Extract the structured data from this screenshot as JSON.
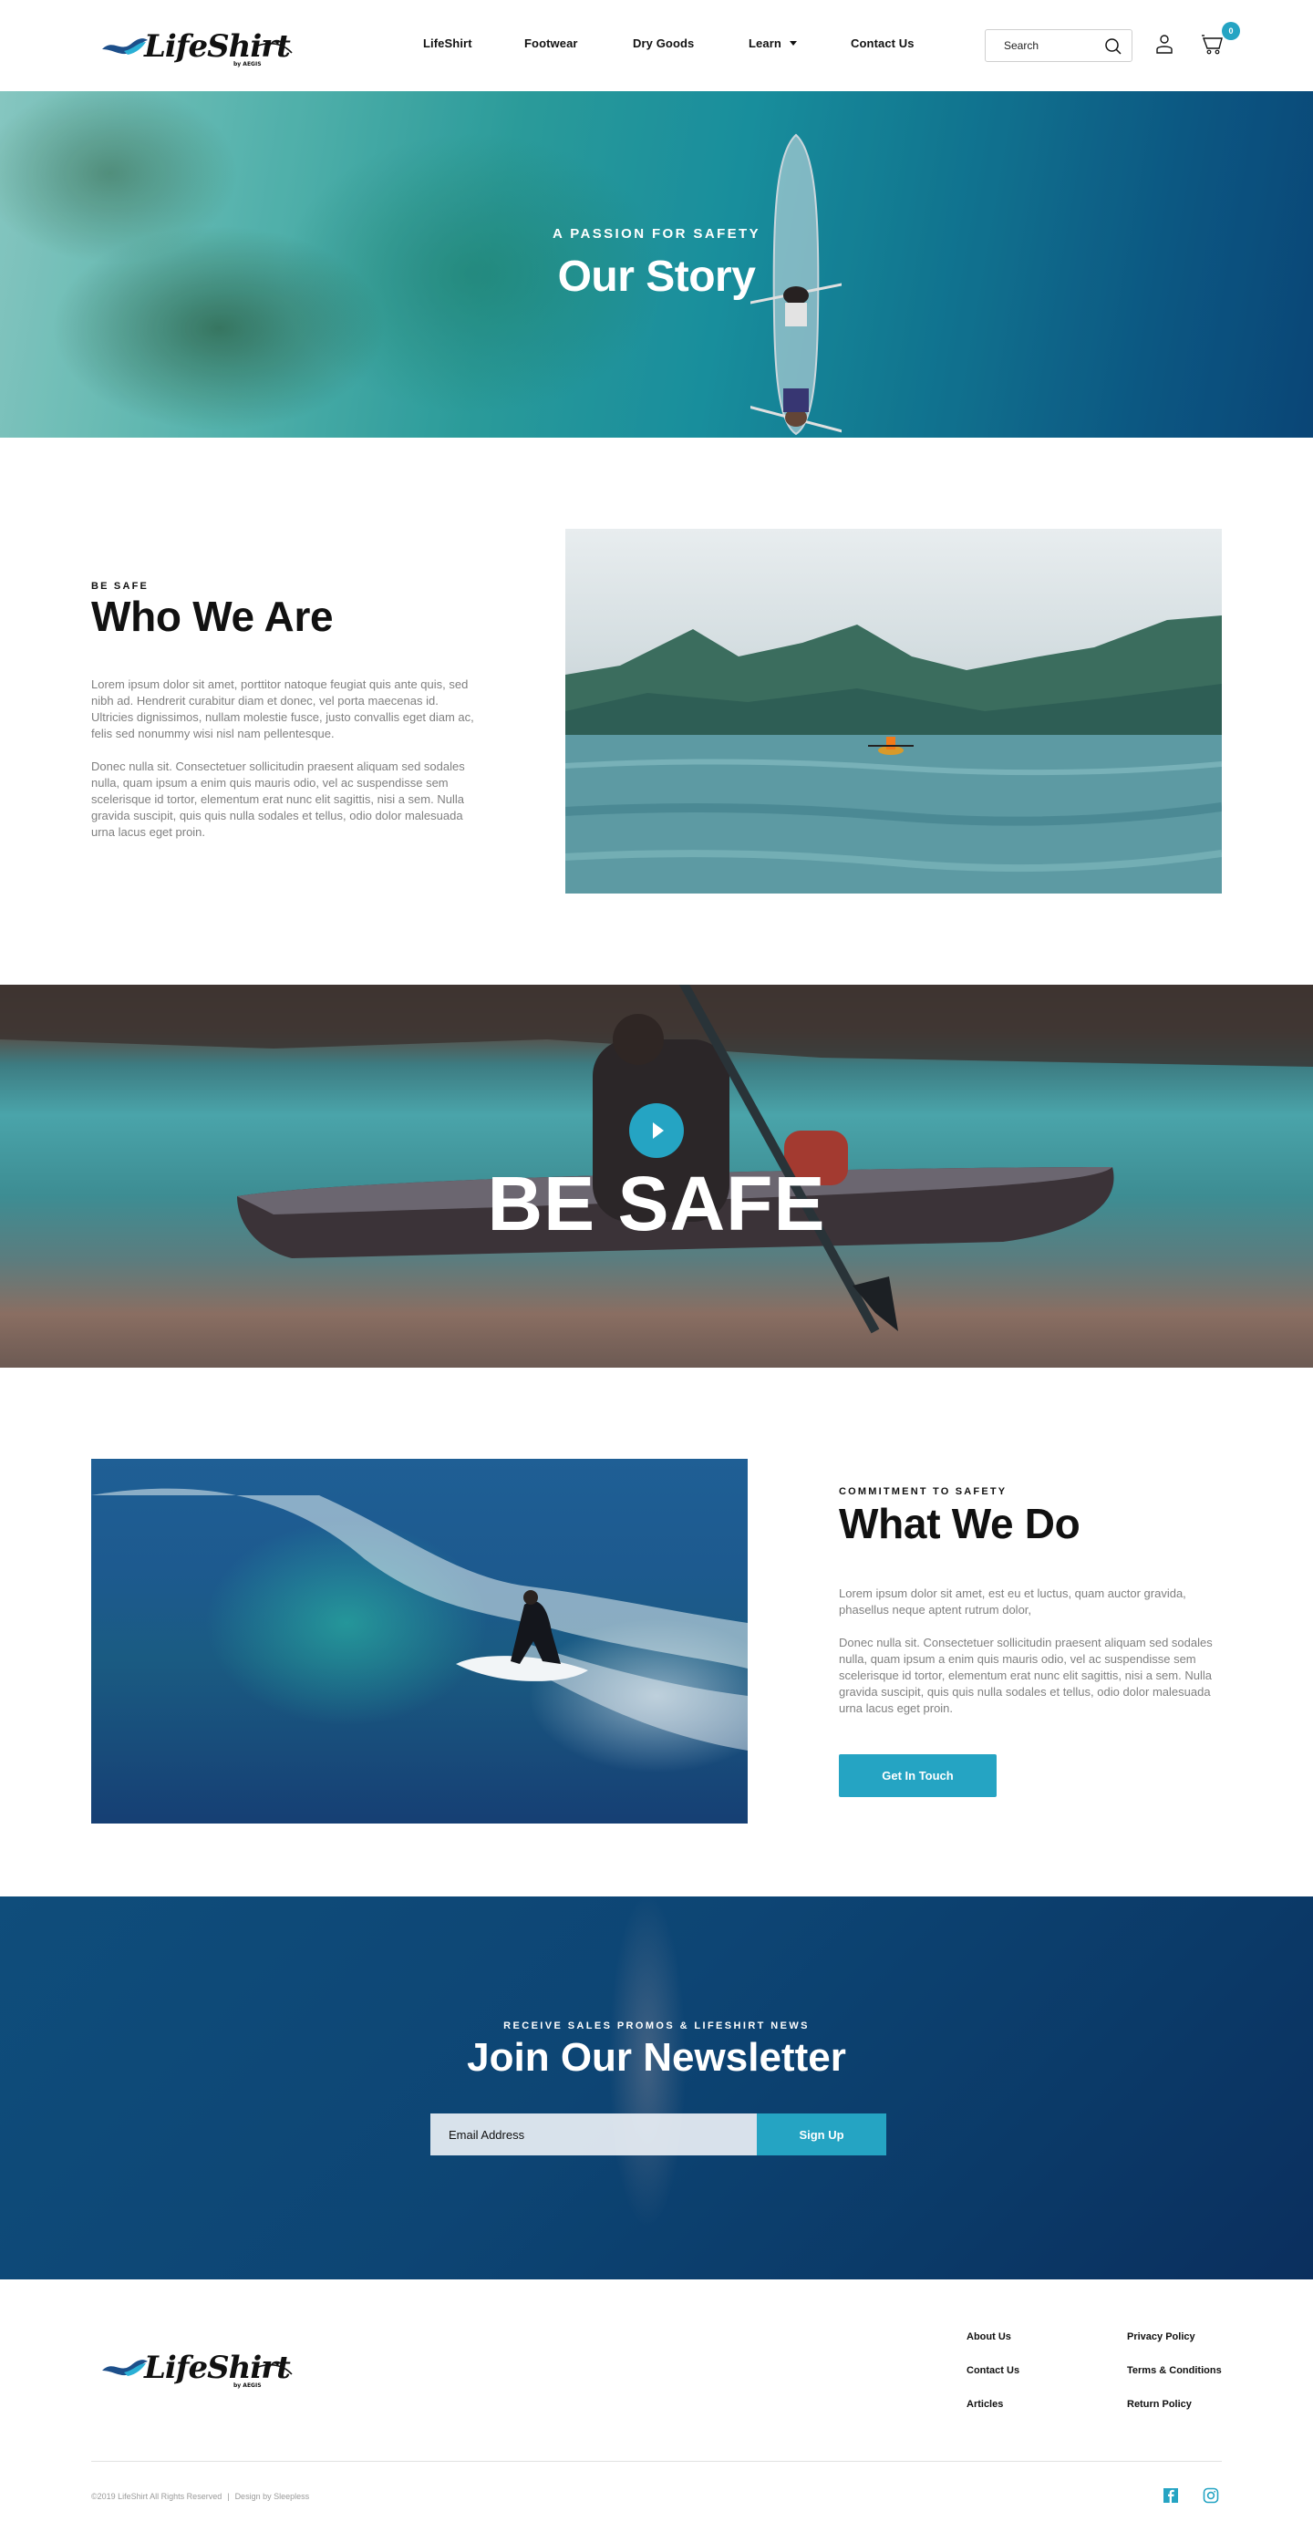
{
  "brand": {
    "name": "LifeShirt",
    "sub": "by AEGIS",
    "accent": "#25a4c3",
    "logo_wave_dark": "#1d4f8a",
    "logo_wave_light": "#2ab0d6"
  },
  "header": {
    "nav": [
      {
        "label": "LifeShirt",
        "has_dropdown": false
      },
      {
        "label": "Footwear",
        "has_dropdown": false
      },
      {
        "label": "Dry Goods",
        "has_dropdown": false
      },
      {
        "label": "Learn",
        "has_dropdown": true
      },
      {
        "label": "Contact Us",
        "has_dropdown": false
      }
    ],
    "search": {
      "placeholder": "Search",
      "value": "",
      "icon": "search-icon"
    },
    "account_icon": "user-icon",
    "cart": {
      "icon": "cart-icon",
      "count": "0"
    }
  },
  "hero": {
    "eyebrow": "A PASSION FOR SAFETY",
    "title": "Our Story"
  },
  "who": {
    "eyebrow": "BE SAFE",
    "title": "Who We Are",
    "paragraphs": [
      "Lorem ipsum dolor sit amet, porttitor natoque feugiat quis ante quis, sed nibh ad. Hendrerit curabitur diam et donec, vel porta maecenas id. Ultricies dignissimos, nullam molestie fusce, justo convallis eget diam ac, felis sed nonummy wisi nisl nam pellentesque.",
      "Donec nulla sit. Consectetuer sollicitudin praesent aliquam sed sodales nulla, quam ipsum a enim quis mauris odio, vel ac suspendisse sem scelerisque id tortor, elementum erat nunc elit sagittis, nisi a sem. Nulla gravida suscipit, quis quis nulla sodales et tellus, odio dolor malesuada urna lacus eget proin."
    ],
    "image_alt": "Kayaker in orange jacket on a mountain lake"
  },
  "banner": {
    "title": "BE SAFE",
    "play_icon": "play-icon"
  },
  "what": {
    "eyebrow": "COMMITMENT TO SAFETY",
    "title": "What We Do",
    "paragraphs": [
      "Lorem ipsum dolor sit amet, est eu et luctus, quam auctor gravida, phasellus neque aptent rutrum dolor,",
      "Donec nulla sit. Consectetuer sollicitudin praesent aliquam sed sodales nulla, quam ipsum a enim quis mauris odio, vel ac suspendisse sem scelerisque id tortor, elementum erat nunc elit sagittis, nisi a sem. Nulla gravida suscipit, quis quis nulla sodales et tellus, odio dolor malesuada urna lacus eget proin."
    ],
    "cta_label": "Get In Touch",
    "image_alt": "Surfer riding a wave"
  },
  "newsletter": {
    "eyebrow": "RECEIVE SALES PROMOS & LIFESHIRT NEWS",
    "title": "Join Our Newsletter",
    "email_placeholder": "Email Address",
    "email_value": "",
    "submit_label": "Sign Up"
  },
  "footer": {
    "links_col1": [
      "About Us",
      "Contact Us",
      "Articles"
    ],
    "links_col2": [
      "Privacy Policy",
      "Terms & Conditions",
      "Return Policy"
    ],
    "copyright": "©2019 LifeShirt All Rights Reserved",
    "separator": "|",
    "credit": "Design by Sleepless",
    "social": [
      {
        "name": "facebook",
        "icon": "facebook-icon"
      },
      {
        "name": "instagram",
        "icon": "instagram-icon"
      }
    ]
  }
}
